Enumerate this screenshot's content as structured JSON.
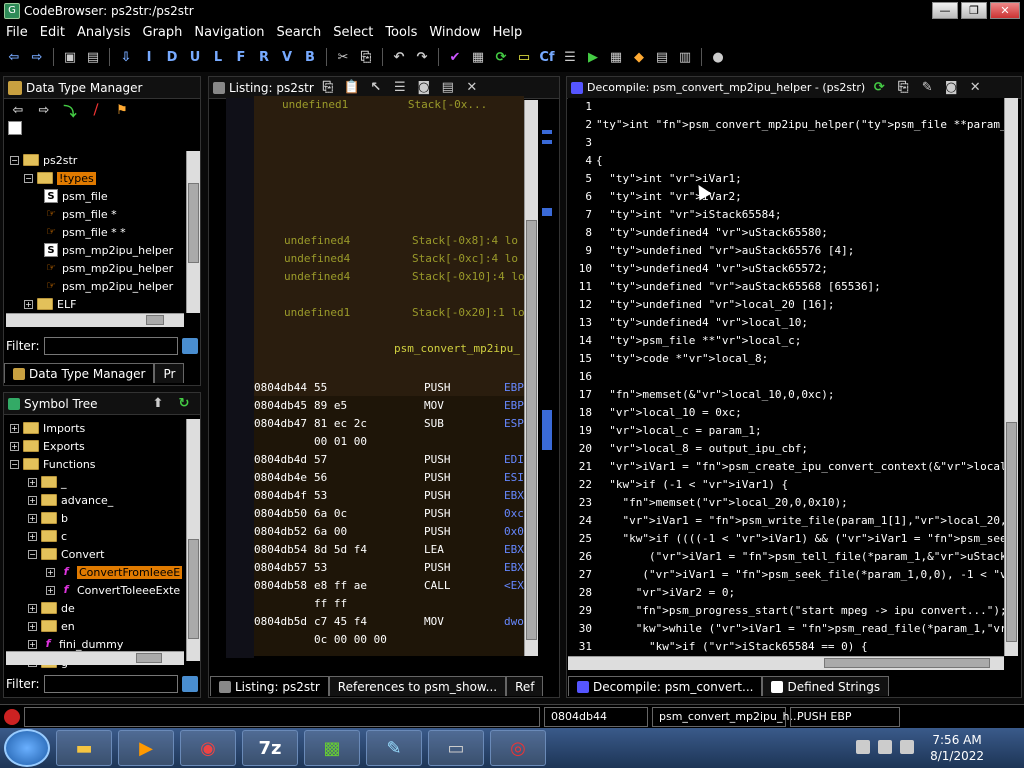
{
  "window": {
    "title": "CodeBrowser: ps2str:/ps2str"
  },
  "menu": [
    "File",
    "Edit",
    "Analysis",
    "Graph",
    "Navigation",
    "Search",
    "Select",
    "Tools",
    "Window",
    "Help"
  ],
  "toolbar": {
    "icons": [
      "back-arrow-icon",
      "forward-arrow-icon",
      "save-icon",
      "down-arrow-icon",
      "I",
      "D",
      "U",
      "L",
      "F",
      "R",
      "V",
      "B",
      "run-icon",
      "check-icon"
    ]
  },
  "data_type_manager": {
    "title": "Data Type Manager",
    "tab_label": "Data Type Manager",
    "tab_label2": "Pr",
    "filter_label": "Filter:",
    "tree": [
      {
        "label": "ps2str",
        "kind": "root"
      },
      {
        "label": "!types",
        "kind": "folder",
        "selected": true
      },
      {
        "label": "psm_file",
        "kind": "struct"
      },
      {
        "label": "psm_file *",
        "kind": "ptr"
      },
      {
        "label": "psm_file * *",
        "kind": "ptr"
      },
      {
        "label": "psm_mp2ipu_helper",
        "kind": "struct"
      },
      {
        "label": "psm_mp2ipu_helper",
        "kind": "ptr"
      },
      {
        "label": "psm_mp2ipu_helper",
        "kind": "ptr"
      },
      {
        "label": "ELF",
        "kind": "folder"
      }
    ]
  },
  "symbol_tree": {
    "title": "Symbol Tree",
    "filter_label": "Filter:",
    "tree": [
      {
        "label": "Imports",
        "indent": 0
      },
      {
        "label": "Exports",
        "indent": 0
      },
      {
        "label": "Functions",
        "indent": 0
      },
      {
        "label": "_",
        "indent": 1
      },
      {
        "label": "advance_",
        "indent": 1
      },
      {
        "label": "b",
        "indent": 1
      },
      {
        "label": "c",
        "indent": 1
      },
      {
        "label": "Convert",
        "indent": 1
      },
      {
        "label": "ConvertFromIeeeE",
        "indent": 2,
        "selected": true
      },
      {
        "label": "ConvertToIeeeExte",
        "indent": 2
      },
      {
        "label": "de",
        "indent": 1
      },
      {
        "label": "en",
        "indent": 1
      },
      {
        "label": "fini_dummy",
        "indent": 1
      },
      {
        "label": "g",
        "indent": 1
      }
    ]
  },
  "listing": {
    "title": "Listing:  ps2str",
    "tab_label": "Listing:  ps2str",
    "tab_refs": "References to psm_show...",
    "tab_refs2": "Ref",
    "rows": [
      {
        "a": "",
        "b": "undefined4",
        "c": "Stack[-0x8]:4  lo"
      },
      {
        "a": "",
        "b": "undefined4",
        "c": "Stack[-0xc]:4  lo"
      },
      {
        "a": "",
        "b": "undefined4",
        "c": "Stack[-0x10]:4 lo"
      },
      {
        "a": "",
        "b": "undefined1",
        "c": "Stack[-0x20]:1 lo"
      },
      {
        "a": "",
        "b": "",
        "c": "psm_convert_mp2ipu_"
      }
    ],
    "code": [
      {
        "addr": "0804db44",
        "bytes": "55",
        "mn": "PUSH",
        "op": "EBP"
      },
      {
        "addr": "0804db45",
        "bytes": "89 e5",
        "mn": "MOV",
        "op": "EBP"
      },
      {
        "addr": "0804db47",
        "bytes": "81 ec 2c",
        "mn": "SUB",
        "op": "ESP"
      },
      {
        "addr": "",
        "bytes": "00 01 00",
        "mn": "",
        "op": ""
      },
      {
        "addr": "0804db4d",
        "bytes": "57",
        "mn": "PUSH",
        "op": "EDI"
      },
      {
        "addr": "0804db4e",
        "bytes": "56",
        "mn": "PUSH",
        "op": "ESI"
      },
      {
        "addr": "0804db4f",
        "bytes": "53",
        "mn": "PUSH",
        "op": "EBX"
      },
      {
        "addr": "0804db50",
        "bytes": "6a 0c",
        "mn": "PUSH",
        "op": "0xc"
      },
      {
        "addr": "0804db52",
        "bytes": "6a 00",
        "mn": "PUSH",
        "op": "0x0"
      },
      {
        "addr": "0804db54",
        "bytes": "8d 5d f4",
        "mn": "LEA",
        "op": "EBX"
      },
      {
        "addr": "0804db57",
        "bytes": "53",
        "mn": "PUSH",
        "op": "EBX"
      },
      {
        "addr": "0804db58",
        "bytes": "e8 ff ae",
        "mn": "CALL",
        "op": "<EX"
      },
      {
        "addr": "",
        "bytes": "ff ff",
        "mn": "",
        "op": ""
      },
      {
        "addr": "0804db5d",
        "bytes": "c7 45 f4",
        "mn": "MOV",
        "op": "dwo"
      },
      {
        "addr": "",
        "bytes": "0c 00 00 00",
        "mn": "",
        "op": ""
      }
    ]
  },
  "decompile": {
    "title": "Decompile: psm_convert_mp2ipu_helper - (ps2str)",
    "tab_label": "Decompile: psm_convert...",
    "tab_label2": "Defined Strings",
    "lines": [
      {
        "n": "1",
        "t": ""
      },
      {
        "n": "2",
        "t": "int psm_convert_mp2ipu_helper(psm_file **param_1)"
      },
      {
        "n": "3",
        "t": ""
      },
      {
        "n": "4",
        "t": "{"
      },
      {
        "n": "5",
        "t": "  int iVar1;"
      },
      {
        "n": "6",
        "t": "  int iVar2;"
      },
      {
        "n": "7",
        "t": "  int iStack65584;"
      },
      {
        "n": "8",
        "t": "  undefined4 uStack65580;"
      },
      {
        "n": "9",
        "t": "  undefined auStack65576 [4];"
      },
      {
        "n": "10",
        "t": "  undefined4 uStack65572;"
      },
      {
        "n": "11",
        "t": "  undefined auStack65568 [65536];"
      },
      {
        "n": "12",
        "t": "  undefined local_20 [16];"
      },
      {
        "n": "13",
        "t": "  undefined4 local_10;"
      },
      {
        "n": "14",
        "t": "  psm_file **local_c;"
      },
      {
        "n": "15",
        "t": "  code *local_8;"
      },
      {
        "n": "16",
        "t": ""
      },
      {
        "n": "17",
        "t": "  memset(&local_10,0,0xc);"
      },
      {
        "n": "18",
        "t": "  local_10 = 0xc;"
      },
      {
        "n": "19",
        "t": "  local_c = param_1;"
      },
      {
        "n": "20",
        "t": "  local_8 = output_ipu_cbf;"
      },
      {
        "n": "21",
        "t": "  iVar1 = psm_create_ipu_convert_context(&local_10,&uStack6"
      },
      {
        "n": "22",
        "t": "  if (-1 < iVar1) {"
      },
      {
        "n": "23",
        "t": "    memset(local_20,0,0x10);"
      },
      {
        "n": "24",
        "t": "    iVar1 = psm_write_file(param_1[1],local_20,0x10,auStack"
      },
      {
        "n": "25",
        "t": "    if ((((-1 < iVar1) && (iVar1 = psm_seek_file(*param_1,0"
      },
      {
        "n": "26",
        "t": "        (iVar1 = psm_tell_file(*param_1,&uStack65580), -1 <"
      },
      {
        "n": "27",
        "t": "       (iVar1 = psm_seek_file(*param_1,0,0), -1 < iVar1)) {"
      },
      {
        "n": "28",
        "t": "      iVar2 = 0;"
      },
      {
        "n": "29",
        "t": "      psm_progress_start(\"start mpeg -> ipu convert...\");"
      },
      {
        "n": "30",
        "t": "      while (iVar1 = psm_read_file(*param_1,auStack65568,0x"
      },
      {
        "n": "31",
        "t": "        if (iStack65584 == 0) {"
      }
    ]
  },
  "status": {
    "addr": "0804db44",
    "func": "psm_convert_mp2ipu_h...",
    "instr": "PUSH EBP"
  },
  "taskbar": {
    "time": "7:56 AM",
    "date": "8/1/2022"
  }
}
